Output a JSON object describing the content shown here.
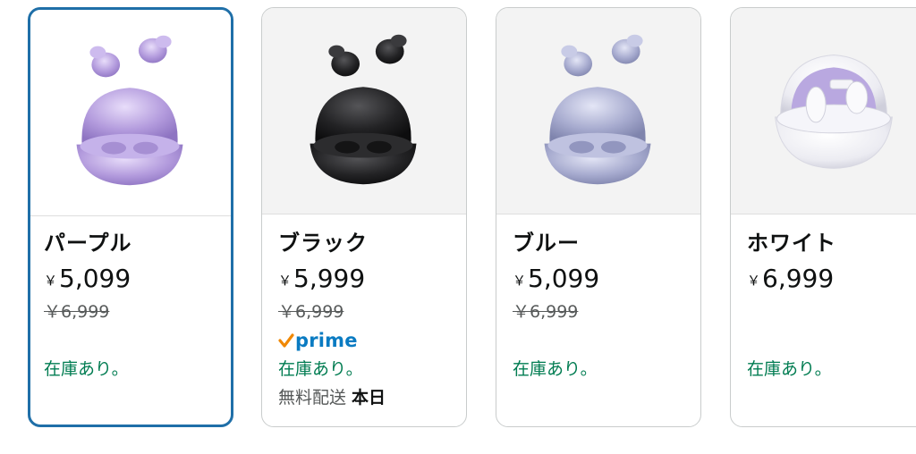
{
  "cards": [
    {
      "name": "パープル",
      "currency": "￥",
      "price": "5,099",
      "old_price": "￥6,999",
      "stock": "在庫あり。",
      "color": "#b6a2dc",
      "selected": true
    },
    {
      "name": "ブラック",
      "currency": "￥",
      "price": "5,999",
      "old_price": "￥6,999",
      "prime_label": "prime",
      "stock": "在庫あり。",
      "delivery_label": "無料配送",
      "delivery_day": "本日",
      "color": "#1e1e20"
    },
    {
      "name": "ブルー",
      "currency": "￥",
      "price": "5,099",
      "old_price": "￥6,999",
      "stock": "在庫あり。",
      "color": "#a9aed0"
    },
    {
      "name": "ホワイト",
      "currency": "￥",
      "price": "6,999",
      "stock": "在庫あり。",
      "color": "#eeeef4"
    }
  ],
  "icons": {
    "prime_check": "check-icon"
  },
  "colors": {
    "selected_border": "#1f6fa8",
    "in_stock": "#007c51",
    "prime_blue": "#0a7bc2",
    "prime_check": "#f08804"
  }
}
